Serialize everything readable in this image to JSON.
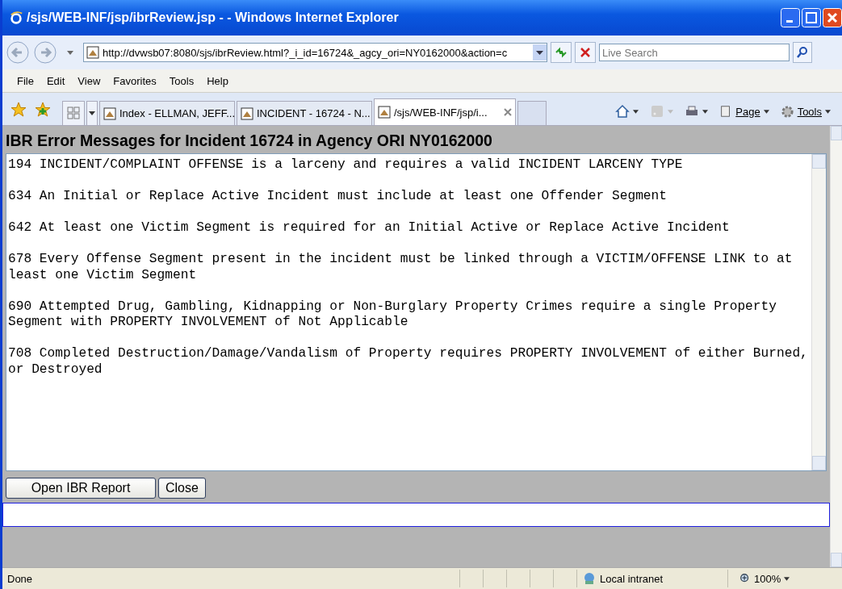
{
  "window": {
    "title": "/sjs/WEB-INF/jsp/ibrReview.jsp - - Windows Internet Explorer"
  },
  "address": {
    "url": "http://dvwsb07:8080/sjs/ibrReview.html?_i_id=16724&_agcy_ori=NY0162000&action=c"
  },
  "search": {
    "placeholder": "Live Search"
  },
  "menu": [
    "File",
    "Edit",
    "View",
    "Favorites",
    "Tools",
    "Help"
  ],
  "tabs": [
    {
      "label": "Index - ELLMAN, JEFF...",
      "selected": false
    },
    {
      "label": "INCIDENT - 16724 - N...",
      "selected": false
    },
    {
      "label": "/sjs/WEB-INF/jsp/i...",
      "selected": true
    }
  ],
  "command_bar": {
    "page": "Page",
    "tools": "Tools"
  },
  "heading": "IBR Error Messages for Incident 16724 in Agency ORI NY0162000",
  "messages": [
    "194 INCIDENT/COMPLAINT OFFENSE is a larceny and requires a valid INCIDENT LARCENY TYPE",
    "634 An Initial or Replace Active Incident must include at least one Offender Segment",
    "642 At least one Victim Segment is required for an Initial Active or Replace Active Incident",
    "678 Every Offense Segment present in the incident must be linked through a VICTIM/OFFENSE LINK to at least one Victim Segment",
    "690 Attempted Drug, Gambling, Kidnapping or Non-Burglary Property Crimes require a single Property Segment with PROPERTY INVOLVEMENT of Not Applicable",
    "708 Completed Destruction/Damage/Vandalism of Property requires PROPERTY INVOLVEMENT of either Burned, or Destroyed"
  ],
  "buttons": [
    "Open IBR Report",
    "Close"
  ],
  "status_bar": {
    "text": "Done",
    "zone": "Local intranet",
    "zoom": "100%"
  }
}
